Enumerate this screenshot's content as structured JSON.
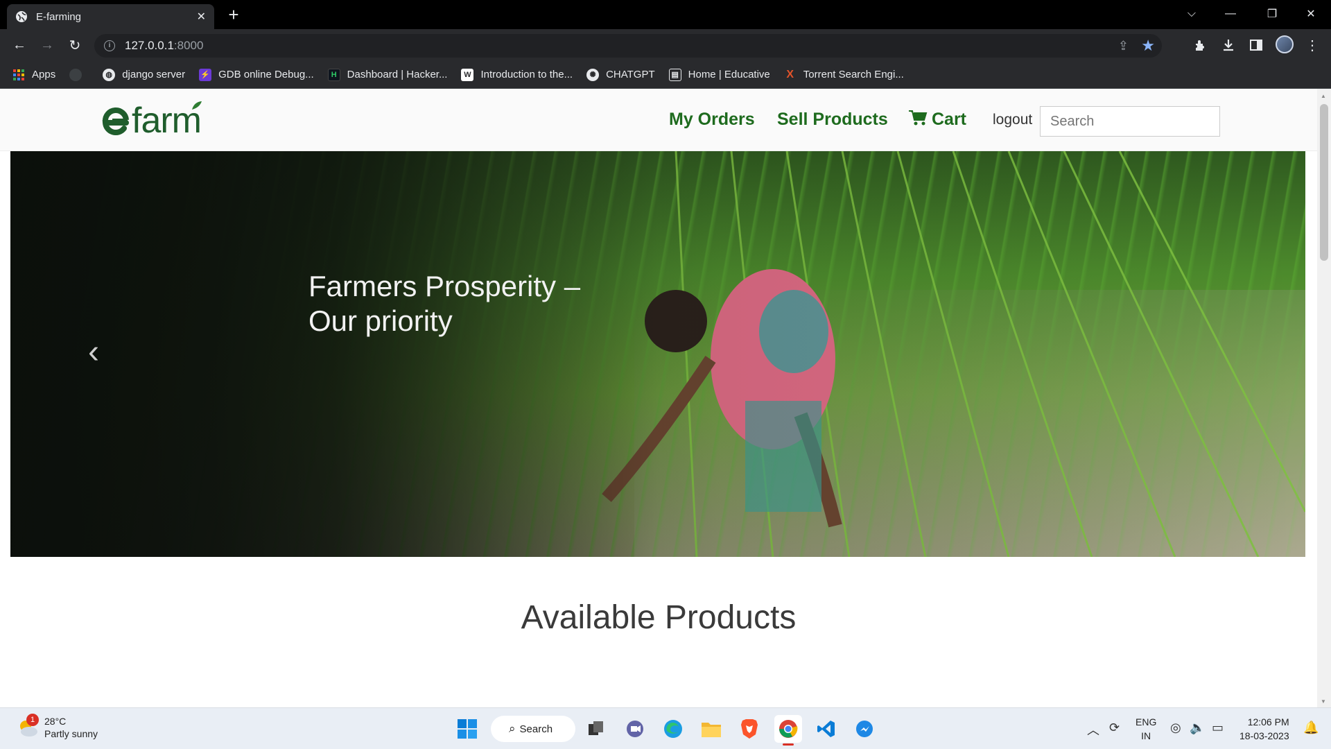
{
  "browser": {
    "tab_title": "E-farming",
    "url_host": "127.0.0.1",
    "url_port": ":8000",
    "bookmarks": [
      {
        "label": "Apps",
        "icon": "apps-grid-icon"
      },
      {
        "label": "",
        "icon": "github-icon"
      },
      {
        "label": "django server",
        "icon": "globe-icon"
      },
      {
        "label": "GDB online Debug...",
        "icon": "gdb-icon"
      },
      {
        "label": "Dashboard | Hacker...",
        "icon": "hackerrank-icon"
      },
      {
        "label": "Introduction to the...",
        "icon": "educative-icon"
      },
      {
        "label": "CHATGPT",
        "icon": "chatgpt-icon"
      },
      {
        "label": "Home | Educative",
        "icon": "educative-home-icon"
      },
      {
        "label": "Torrent Search Engi...",
        "icon": "torrent-icon"
      }
    ]
  },
  "site": {
    "logo_text": "farm",
    "nav": {
      "my_orders": "My Orders",
      "sell_products": "Sell Products",
      "cart": "Cart",
      "logout": "logout"
    },
    "search_placeholder": "Search",
    "hero": {
      "caption_line1": "Farmers Prosperity –",
      "caption_line2": "Our priority"
    },
    "section_title": "Available Products",
    "colors": {
      "brand_green": "#1e6b1e",
      "logo_green": "#1f5d2c"
    }
  },
  "taskbar": {
    "weather_temp": "28°C",
    "weather_desc": "Partly sunny",
    "weather_badge": "1",
    "search_label": "Search",
    "lang_line1": "ENG",
    "lang_line2": "IN",
    "time": "12:06 PM",
    "date": "18-03-2023"
  }
}
